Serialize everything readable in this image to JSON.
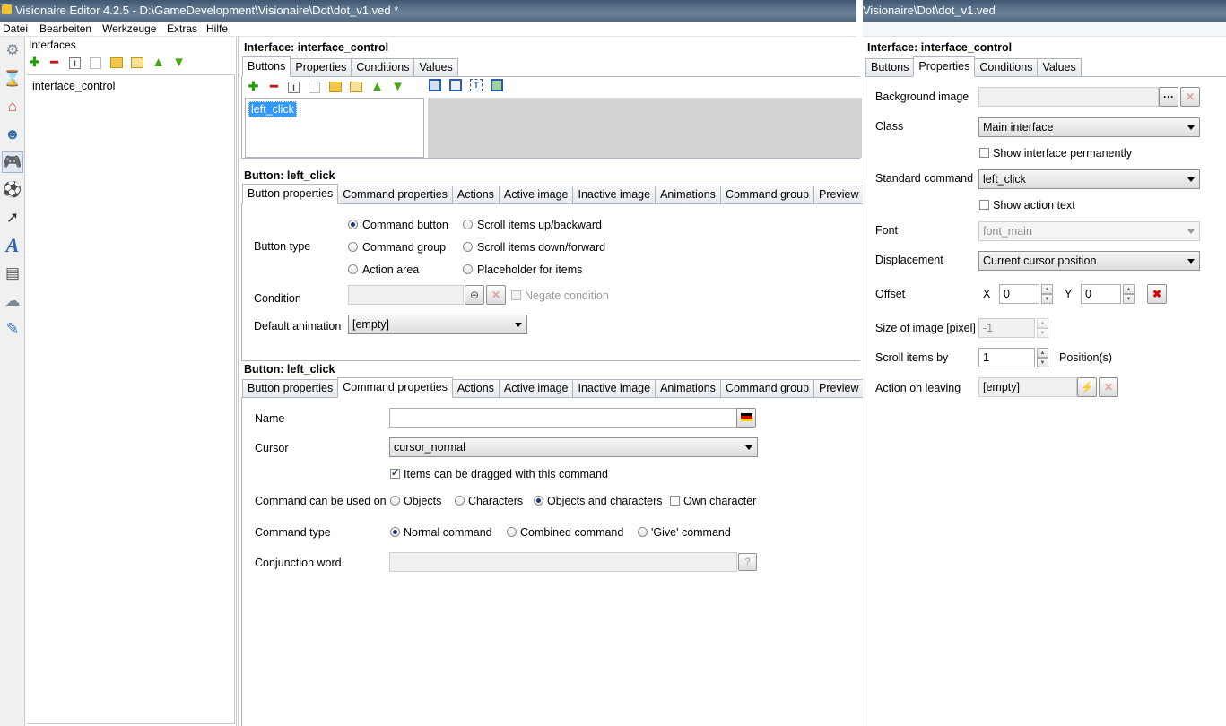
{
  "window": {
    "title": "Visionaire Editor 4.2.5 - D:\\GameDevelopment\\Visionaire\\Dot\\dot_v1.ved *",
    "title_right": "Visionaire\\Dot\\dot_v1.ved"
  },
  "menu": [
    "Datei",
    "Bearbeiten",
    "Werkzeuge",
    "Extras",
    "Hilfe"
  ],
  "sidebar_icons": [
    "settings-gear-icon",
    "hourglass-icon",
    "house-icon",
    "character-icon",
    "gamepad-icon",
    "ball-icon",
    "cursor-arrow-icon",
    "font-a-icon",
    "text-document-icon",
    "weather-cloud-icon",
    "scroll-script-icon"
  ],
  "interfaces_panel": {
    "title": "Interfaces",
    "items": [
      "interface_control"
    ]
  },
  "interface_header": "Interface: interface_control",
  "interface_tabs": [
    "Buttons",
    "Properties",
    "Conditions",
    "Values"
  ],
  "buttons_list": [
    "left_click"
  ],
  "button_header_1": "Button: left_click",
  "button_header_2": "Button: left_click",
  "button_tabs": [
    "Button properties",
    "Command properties",
    "Actions",
    "Active image",
    "Inactive image",
    "Animations",
    "Command group",
    "Preview"
  ],
  "button_properties": {
    "button_type_label": "Button type",
    "options": [
      "Command button",
      "Scroll items up/backward",
      "Command group",
      "Scroll items down/forward",
      "Action area",
      "Placeholder for items"
    ],
    "selected": "Command button",
    "condition_label": "Condition",
    "negate_condition": "Negate condition",
    "default_animation_label": "Default animation",
    "default_animation_value": "[empty]"
  },
  "command_properties": {
    "name_label": "Name",
    "name_value": "",
    "cursor_label": "Cursor",
    "cursor_value": "cursor_normal",
    "drag_checkbox": "Items can be dragged with this command",
    "drag_checked": true,
    "used_on_label": "Command can be used on",
    "used_on_options": [
      "Objects",
      "Characters",
      "Objects and characters"
    ],
    "used_on_selected": "Objects and characters",
    "own_character": "Own character",
    "command_type_label": "Command type",
    "command_type_options": [
      "Normal command",
      "Combined command",
      "'Give' command"
    ],
    "command_type_selected": "Normal command",
    "conjunction_label": "Conjunction word",
    "conjunction_value": ""
  },
  "right_panel": {
    "header": "Interface: interface_control",
    "tabs": [
      "Buttons",
      "Properties",
      "Conditions",
      "Values"
    ],
    "active_tab": "Properties",
    "background_image_label": "Background image",
    "class_label": "Class",
    "class_value": "Main interface",
    "show_permanently": "Show interface permanently",
    "standard_command_label": "Standard command",
    "standard_command_value": "left_click",
    "show_action_text": "Show action text",
    "font_label": "Font",
    "font_value": "font_main",
    "displacement_label": "Displacement",
    "displacement_value": "Current cursor position",
    "offset_label": "Offset",
    "offset_x_label": "X",
    "offset_x": "0",
    "offset_y_label": "Y",
    "offset_y": "0",
    "size_label": "Size of image [pixel]",
    "size_value": "-1",
    "scroll_label": "Scroll items by",
    "scroll_value": "1",
    "scroll_unit": "Position(s)",
    "action_leaving_label": "Action on leaving",
    "action_leaving_value": "[empty]"
  }
}
